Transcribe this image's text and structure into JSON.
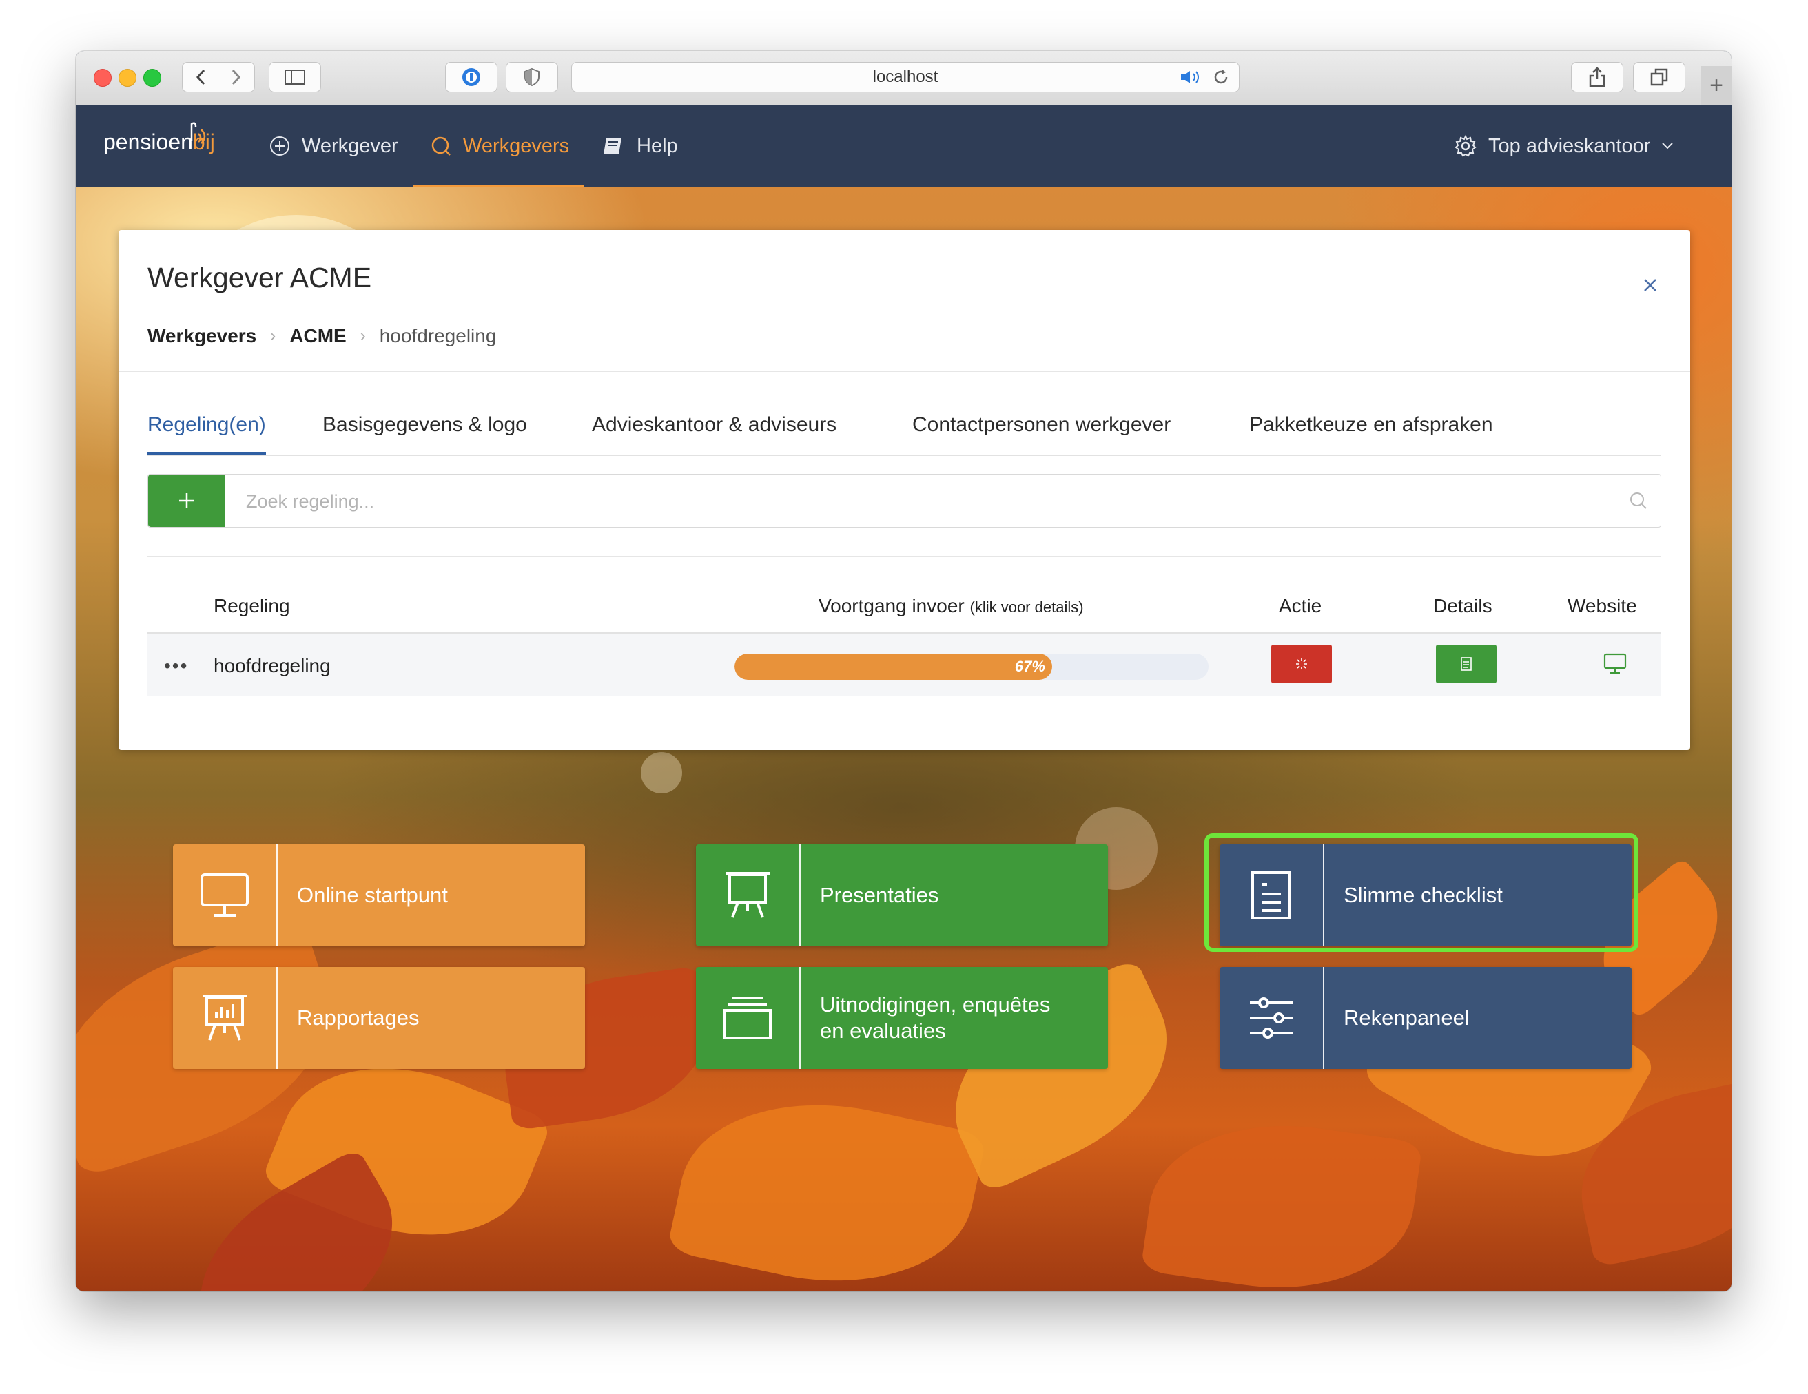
{
  "browser": {
    "url": "localhost"
  },
  "app": {
    "logo": {
      "part1": "pensioen",
      "part2": "bij"
    },
    "nav": {
      "werkgever": "Werkgever",
      "werkgevers": "Werkgevers",
      "help": "Help",
      "account": "Top advieskantoor"
    }
  },
  "card": {
    "title": "Werkgever ACME",
    "breadcrumb": [
      "Werkgevers",
      "ACME",
      "hoofdregeling"
    ],
    "tabs": [
      "Regeling(en)",
      "Basisgegevens & logo",
      "Advieskantoor & adviseurs",
      "Contactpersonen werkgever",
      "Pakketkeuze en afspraken"
    ],
    "active_tab": "Regeling(en)",
    "search": {
      "placeholder": "Zoek regeling..."
    },
    "table": {
      "headers": {
        "regeling": "Regeling",
        "voortgang": "Voortgang invoer",
        "voortgang_hint": "(klik voor details)",
        "actie": "Actie",
        "details": "Details",
        "website": "Website"
      },
      "rows": [
        {
          "menu": "•••",
          "name": "hoofdregeling",
          "progress": 67,
          "progress_label": "67%"
        }
      ]
    }
  },
  "tiles": {
    "online_startpunt": "Online startpunt",
    "rapportages": "Rapportages",
    "presentaties": "Presentaties",
    "uitnodigingen_line1": "Uitnodigingen, enquêtes",
    "uitnodigingen_line2": "en evaluaties",
    "slimme_checklist": "Slimme checklist",
    "rekenpaneel": "Rekenpaneel"
  },
  "colors": {
    "nav_bg": "#2f3d56",
    "accent_orange": "#f39a3c",
    "tile_orange": "#e9973f",
    "tile_green": "#3f9a3a",
    "tile_navy": "#3b5478",
    "action_red": "#cc3328",
    "highlight_green": "#6ee63a"
  },
  "icons": [
    "back-icon",
    "forward-icon",
    "sidebar-icon",
    "password-icon",
    "shield-icon",
    "sound-icon",
    "reload-icon",
    "share-icon",
    "tabs-icon",
    "plus-circle-icon",
    "search-icon",
    "book-icon",
    "gear-icon",
    "chevron-down-icon",
    "close-icon",
    "monitor-icon",
    "presentation-icon",
    "document-icon",
    "chart-board-icon",
    "stack-icon",
    "sliders-icon",
    "spinner-icon"
  ]
}
